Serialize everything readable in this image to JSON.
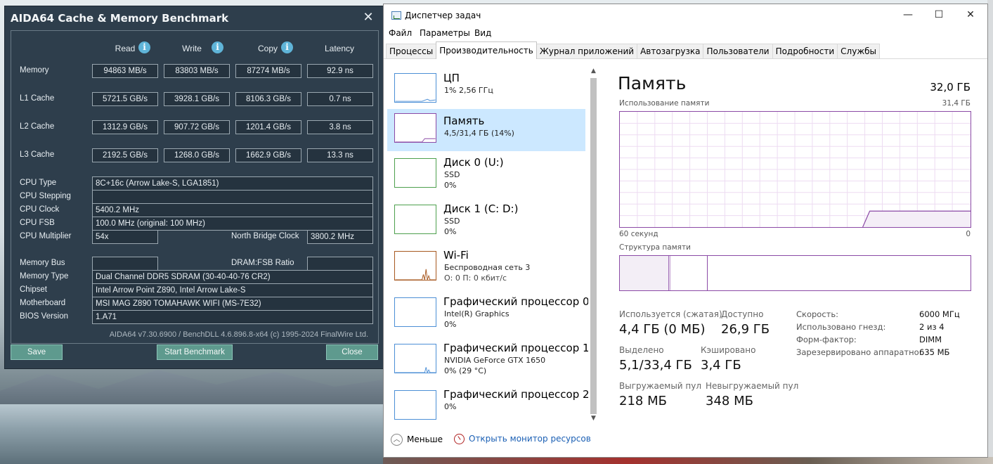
{
  "aida": {
    "title": "AIDA64 Cache & Memory Benchmark",
    "close_glyph": "✕",
    "columns": {
      "read": "Read",
      "write": "Write",
      "copy": "Copy",
      "latency": "Latency"
    },
    "rows": [
      {
        "label": "Memory",
        "read": "94863 MB/s",
        "write": "83803 MB/s",
        "copy": "87274 MB/s",
        "latency": "92.9 ns"
      },
      {
        "label": "L1 Cache",
        "read": "5721.5 GB/s",
        "write": "3928.1 GB/s",
        "copy": "8106.3 GB/s",
        "latency": "0.7 ns"
      },
      {
        "label": "L2 Cache",
        "read": "1312.9 GB/s",
        "write": "907.72 GB/s",
        "copy": "1201.4 GB/s",
        "latency": "3.8 ns"
      },
      {
        "label": "L3 Cache",
        "read": "2192.5 GB/s",
        "write": "1268.0 GB/s",
        "copy": "1662.9 GB/s",
        "latency": "13.3 ns"
      }
    ],
    "info": {
      "cpu_type": {
        "label": "CPU Type",
        "value": "8C+16c   (Arrow Lake-S, LGA1851)"
      },
      "cpu_stepping": {
        "label": "CPU Stepping",
        "value": ""
      },
      "cpu_clock": {
        "label": "CPU Clock",
        "value": "5400.2 MHz"
      },
      "cpu_fsb": {
        "label": "CPU FSB",
        "value": "100.0 MHz  (original: 100 MHz)"
      },
      "cpu_multiplier": {
        "label": "CPU Multiplier",
        "value": "54x"
      },
      "nb_clock": {
        "label": "North Bridge Clock",
        "value": "3800.2 MHz"
      },
      "memory_bus": {
        "label": "Memory Bus",
        "value": ""
      },
      "dram_fsb": {
        "label": "DRAM:FSB Ratio",
        "value": ""
      },
      "memory_type": {
        "label": "Memory Type",
        "value": "Dual Channel DDR5 SDRAM  (30-40-40-76 CR2)"
      },
      "chipset": {
        "label": "Chipset",
        "value": "Intel Arrow Point Z890, Intel Arrow Lake-S"
      },
      "motherboard": {
        "label": "Motherboard",
        "value": "MSI MAG Z890 TOMAHAWK WIFI (MS-7E32)"
      },
      "bios": {
        "label": "BIOS Version",
        "value": "1.A71"
      }
    },
    "footer": "AIDA64 v7.30.6900 / BenchDLL 4.6.896.8-x64  (c) 1995-2024 FinalWire Ltd.",
    "buttons": {
      "save": "Save",
      "start": "Start Benchmark",
      "close": "Close"
    }
  },
  "taskmgr": {
    "title": "Диспетчер задач",
    "win_buttons": {
      "minimize": "—",
      "maximize": "☐",
      "close": "✕"
    },
    "menu": [
      "Файл",
      "Параметры",
      "Вид"
    ],
    "tabs": [
      "Процессы",
      "Производительность",
      "Журнал приложений",
      "Автозагрузка",
      "Пользователи",
      "Подробности",
      "Службы"
    ],
    "active_tab": 1,
    "sidebar": [
      {
        "name": "ЦП",
        "sub1": "1% 2,56 ГГц",
        "sub2": "",
        "sub3": "",
        "color": "#4c8fd6"
      },
      {
        "name": "Память",
        "sub1": "4,5/31,4 ГБ (14%)",
        "sub2": "",
        "sub3": "",
        "color": "#8b4aa6"
      },
      {
        "name": "Диск 0 (U:)",
        "sub1": "SSD",
        "sub2": "0%",
        "sub3": "",
        "color": "#4da04d"
      },
      {
        "name": "Диск 1 (C: D:)",
        "sub1": "SSD",
        "sub2": "0%",
        "sub3": "",
        "color": "#4da04d"
      },
      {
        "name": "Wi-Fi",
        "sub1": "Беспроводная сеть 3",
        "sub2": "О: 0 П: 0 кбит/с",
        "sub3": "",
        "color": "#a7581f"
      },
      {
        "name": "Графический процессор 0",
        "sub1": "Intel(R) Graphics",
        "sub2": "0%",
        "sub3": "",
        "color": "#4c8fd6"
      },
      {
        "name": "Графический процессор 1",
        "sub1": "NVIDIA GeForce GTX 1650",
        "sub2": "0%  (29 °C)",
        "sub3": "",
        "color": "#4c8fd6"
      },
      {
        "name": "Графический процессор 2",
        "sub1": "0%",
        "sub2": "",
        "sub3": "",
        "color": "#4c8fd6"
      }
    ],
    "main": {
      "title": "Память",
      "total": "32,0 ГБ",
      "usage_label": "Использование памяти",
      "usage_max": "31,4 ГБ",
      "axis_left": "60 секунд",
      "axis_right": "0",
      "structure_label": "Структура памяти",
      "stats": {
        "in_use_label": "Используется (сжатая)",
        "in_use": "4,4 ГБ (0 МБ)",
        "available_label": "Доступно",
        "available": "26,9 ГБ",
        "committed_label": "Выделено",
        "committed": "5,1/33,4 ГБ",
        "cached_label": "Кэшировано",
        "cached": "3,4 ГБ",
        "paged_label": "Выгружаемый пул",
        "paged": "218 МБ",
        "nonpaged_label": "Невыгружаемый пул",
        "nonpaged": "348 МБ"
      },
      "specs": [
        {
          "label": "Скорость:",
          "value": "6000 МГц"
        },
        {
          "label": "Использовано гнезд:",
          "value": "2 из 4"
        },
        {
          "label": "Форм-фактор:",
          "value": "DIMM"
        },
        {
          "label": "Зарезервировано аппаратно:",
          "value": "635 МБ"
        }
      ]
    },
    "footer": {
      "less": "Меньше",
      "monitor": "Открыть монитор ресурсов"
    }
  }
}
